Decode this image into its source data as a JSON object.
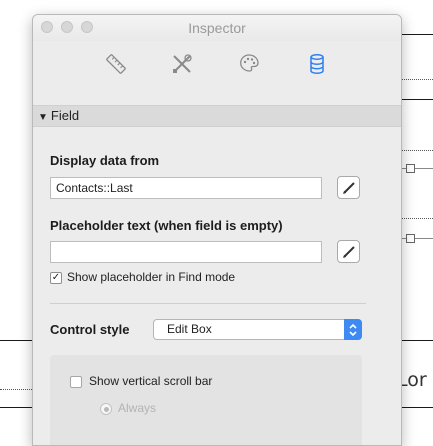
{
  "window": {
    "title": "Inspector"
  },
  "toolbar": {
    "tabs": [
      {
        "icon": "ruler-icon",
        "selected": false
      },
      {
        "icon": "wrench-screwdriver-icon",
        "selected": false
      },
      {
        "icon": "palette-icon",
        "selected": false
      },
      {
        "icon": "database-icon",
        "selected": true
      }
    ]
  },
  "section": {
    "title": "Field",
    "expanded": true
  },
  "display_data": {
    "label": "Display data from",
    "value": "Contacts::Last"
  },
  "placeholder": {
    "label": "Placeholder text (when field is empty)",
    "value": "",
    "find_mode_label": "Show placeholder in Find mode",
    "find_mode_checked": true
  },
  "control_style": {
    "label": "Control style",
    "selected": "Edit Box"
  },
  "scroll_bar": {
    "label": "Show vertical scroll bar",
    "checked": false,
    "always_label": "Always",
    "always_selected": true
  },
  "background_text": "Lor",
  "colors": {
    "accent": "#3d8bf2",
    "panel": "#ececec",
    "header": "#dadada"
  }
}
